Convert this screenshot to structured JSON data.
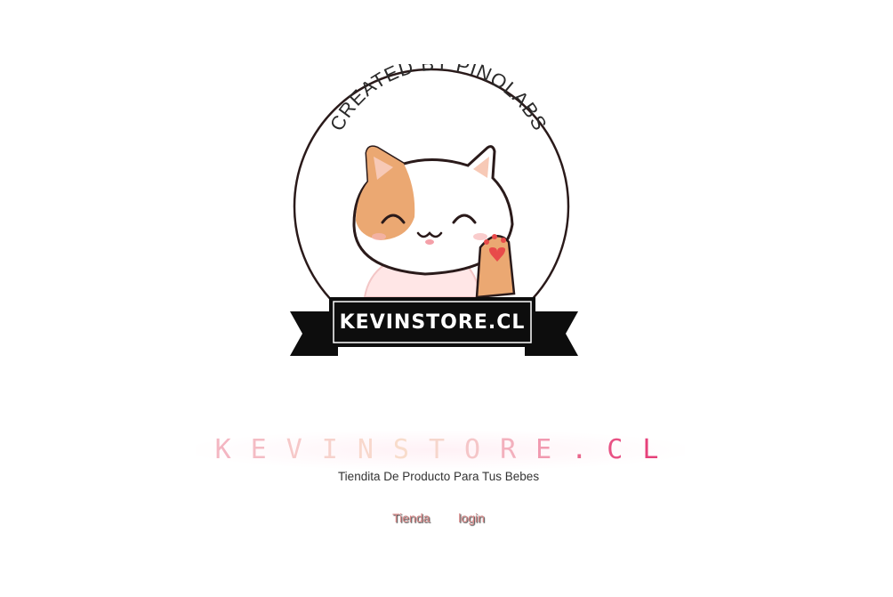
{
  "logo": {
    "ring_text": "CREATED BY PINOLABS",
    "banner_text": "KEVINSTORE.CL"
  },
  "brand": {
    "letters": [
      "K",
      "E",
      "V",
      "I",
      "N",
      "S",
      "T",
      "O",
      "R",
      "E",
      ".",
      "C",
      "L"
    ],
    "colors": [
      "#f4b6c2",
      "#f4bcc4",
      "#f6c8c8",
      "#f7d2cc",
      "#f8d8cc",
      "#f8dccb",
      "#f6d6cc",
      "#f5c6c8",
      "#f3b0bd",
      "#f19ab0",
      "#e9668c",
      "#e85284",
      "#e6417a"
    ]
  },
  "tagline": "Tiendita De Producto Para Tus Bebes",
  "nav": {
    "items": [
      {
        "label": "Tienda"
      },
      {
        "label": "login"
      }
    ]
  },
  "colors": {
    "link": "#d98a8a",
    "banner": "#0d0d0d",
    "cat_orange": "#eba872",
    "heart": "#e84a4a"
  }
}
